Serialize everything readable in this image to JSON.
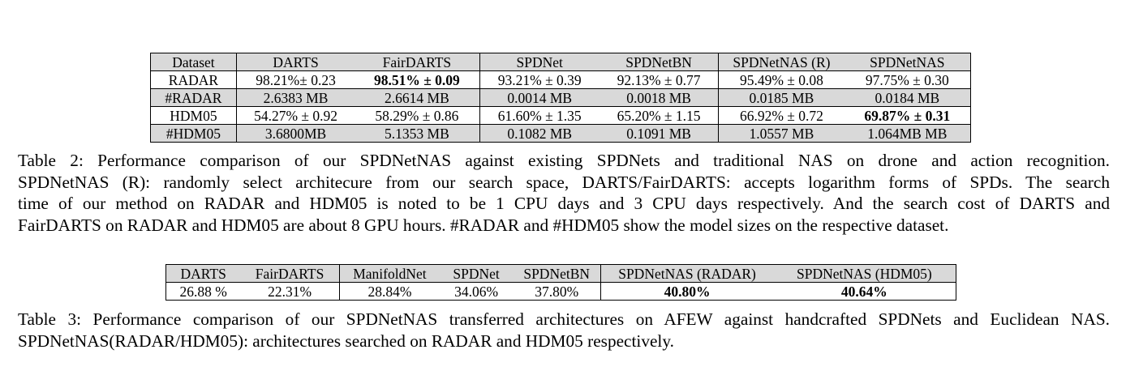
{
  "table2": {
    "headers": [
      "Dataset",
      "DARTS",
      "FairDARTS",
      "SPDNet",
      "SPDNetBN",
      "SPDNetNAS (R)",
      "SPDNetNAS"
    ],
    "rows": [
      [
        "RADAR",
        "98.21%± 0.23",
        "98.51% ± 0.09",
        "93.21% ± 0.39",
        "92.13% ± 0.77",
        "95.49% ± 0.08",
        "97.75% ± 0.30"
      ],
      [
        "#RADAR",
        "2.6383 MB",
        "2.6614 MB",
        "0.0014 MB",
        "0.0018 MB",
        "0.0185 MB",
        "0.0184 MB"
      ],
      [
        "HDM05",
        "54.27% ± 0.92",
        "58.29% ± 0.86",
        "61.60% ± 1.35",
        "65.20% ± 1.15",
        "66.92% ± 0.72",
        "69.87% ± 0.31"
      ],
      [
        "#HDM05",
        "3.6800MB",
        "5.1353 MB",
        "0.1082 MB",
        "0.1091 MB",
        "1.0557 MB",
        "1.064MB MB"
      ]
    ],
    "caption_lines": [
      "Table 2: Performance comparison of our SPDNetNAS against existing SPDNets and traditional NAS on drone and action recognition.",
      "SPDNetNAS (R): randomly select architecure from our search space, DARTS/FairDARTS: accepts logarithm forms of SPDs. The search",
      "time of our method on RADAR and HDM05 is noted to be 1 CPU days and 3 CPU days respectively. And the search cost of DARTS and",
      "FairDARTS on RADAR and HDM05 are about 8 GPU hours. #RADAR and #HDM05 show the model sizes on the respective dataset."
    ]
  },
  "table3": {
    "headers": [
      "DARTS",
      "FairDARTS",
      "ManifoldNet",
      "SPDNet",
      "SPDNetBN",
      "SPDNetNAS (RADAR)",
      "SPDNetNAS (HDM05)"
    ],
    "row": [
      "26.88 %",
      "22.31%",
      "28.84%",
      "34.06%",
      "37.80%",
      "40.80%",
      "40.64%"
    ],
    "caption_lines": [
      "Table 3: Performance comparison of our SPDNetNAS transferred architectures on AFEW against handcrafted SPDNets and Euclidean NAS.",
      "SPDNetNAS(RADAR/HDM05): architectures searched on RADAR and HDM05 respectively."
    ]
  }
}
